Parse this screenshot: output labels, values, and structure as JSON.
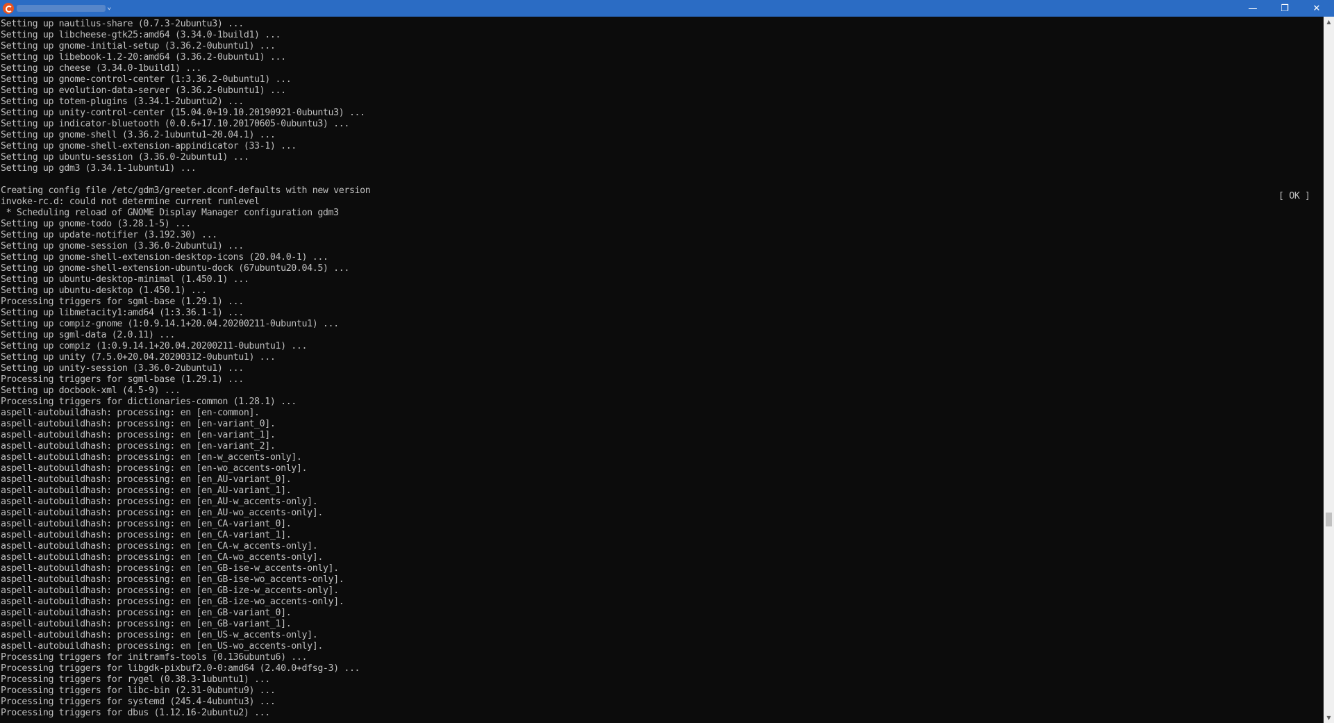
{
  "window": {
    "title_chevron": "⌄",
    "minimize": "—",
    "restore": "❐",
    "close": "✕"
  },
  "terminal": {
    "lines": [
      "Setting up nautilus-share (0.7.3-2ubuntu3) ...",
      "Setting up libcheese-gtk25:amd64 (3.34.0-1build1) ...",
      "Setting up gnome-initial-setup (3.36.2-0ubuntu1) ...",
      "Setting up libebook-1.2-20:amd64 (3.36.2-0ubuntu1) ...",
      "Setting up cheese (3.34.0-1build1) ...",
      "Setting up gnome-control-center (1:3.36.2-0ubuntu1) ...",
      "Setting up evolution-data-server (3.36.2-0ubuntu1) ...",
      "Setting up totem-plugins (3.34.1-2ubuntu2) ...",
      "Setting up unity-control-center (15.04.0+19.10.20190921-0ubuntu3) ...",
      "Setting up indicator-bluetooth (0.0.6+17.10.20170605-0ubuntu3) ...",
      "Setting up gnome-shell (3.36.2-1ubuntu1~20.04.1) ...",
      "Setting up gnome-shell-extension-appindicator (33-1) ...",
      "Setting up ubuntu-session (3.36.0-2ubuntu1) ...",
      "Setting up gdm3 (3.34.1-1ubuntu1) ...",
      "",
      "Creating config file /etc/gdm3/greeter.dconf-defaults with new version",
      "invoke-rc.d: could not determine current runlevel",
      " * Scheduling reload of GNOME Display Manager configuration gdm3",
      "Setting up gnome-todo (3.28.1-5) ...",
      "Setting up update-notifier (3.192.30) ...",
      "Setting up gnome-session (3.36.0-2ubuntu1) ...",
      "Setting up gnome-shell-extension-desktop-icons (20.04.0-1) ...",
      "Setting up gnome-shell-extension-ubuntu-dock (67ubuntu20.04.5) ...",
      "Setting up ubuntu-desktop-minimal (1.450.1) ...",
      "Setting up ubuntu-desktop (1.450.1) ...",
      "Processing triggers for sgml-base (1.29.1) ...",
      "Setting up libmetacity1:amd64 (1:3.36.1-1) ...",
      "Setting up compiz-gnome (1:0.9.14.1+20.04.20200211-0ubuntu1) ...",
      "Setting up sgml-data (2.0.11) ...",
      "Setting up compiz (1:0.9.14.1+20.04.20200211-0ubuntu1) ...",
      "Setting up unity (7.5.0+20.04.20200312-0ubuntu1) ...",
      "Setting up unity-session (3.36.0-2ubuntu1) ...",
      "Processing triggers for sgml-base (1.29.1) ...",
      "Setting up docbook-xml (4.5-9) ...",
      "Processing triggers for dictionaries-common (1.28.1) ...",
      "aspell-autobuildhash: processing: en [en-common].",
      "aspell-autobuildhash: processing: en [en-variant_0].",
      "aspell-autobuildhash: processing: en [en-variant_1].",
      "aspell-autobuildhash: processing: en [en-variant_2].",
      "aspell-autobuildhash: processing: en [en-w_accents-only].",
      "aspell-autobuildhash: processing: en [en-wo_accents-only].",
      "aspell-autobuildhash: processing: en [en_AU-variant_0].",
      "aspell-autobuildhash: processing: en [en_AU-variant_1].",
      "aspell-autobuildhash: processing: en [en_AU-w_accents-only].",
      "aspell-autobuildhash: processing: en [en_AU-wo_accents-only].",
      "aspell-autobuildhash: processing: en [en_CA-variant_0].",
      "aspell-autobuildhash: processing: en [en_CA-variant_1].",
      "aspell-autobuildhash: processing: en [en_CA-w_accents-only].",
      "aspell-autobuildhash: processing: en [en_CA-wo_accents-only].",
      "aspell-autobuildhash: processing: en [en_GB-ise-w_accents-only].",
      "aspell-autobuildhash: processing: en [en_GB-ise-wo_accents-only].",
      "aspell-autobuildhash: processing: en [en_GB-ize-w_accents-only].",
      "aspell-autobuildhash: processing: en [en_GB-ize-wo_accents-only].",
      "aspell-autobuildhash: processing: en [en_GB-variant_0].",
      "aspell-autobuildhash: processing: en [en_GB-variant_1].",
      "aspell-autobuildhash: processing: en [en_US-w_accents-only].",
      "aspell-autobuildhash: processing: en [en_US-wo_accents-only].",
      "Processing triggers for initramfs-tools (0.136ubuntu6) ...",
      "Processing triggers for libgdk-pixbuf2.0-0:amd64 (2.40.0+dfsg-3) ...",
      "Processing triggers for rygel (0.38.3-1ubuntu1) ...",
      "Processing triggers for libc-bin (2.31-0ubuntu9) ...",
      "Processing triggers for systemd (245.4-4ubuntu3) ...",
      "Processing triggers for dbus (1.12.16-2ubuntu2) ..."
    ],
    "ok_status": "[ OK ]"
  },
  "scrollbar": {
    "up_arrow": "▲",
    "down_arrow": "▼"
  },
  "colors": {
    "titlebar": "#2b6cc4",
    "terminal_background": "#0c0c0c",
    "terminal_text": "#c0c0c0"
  }
}
